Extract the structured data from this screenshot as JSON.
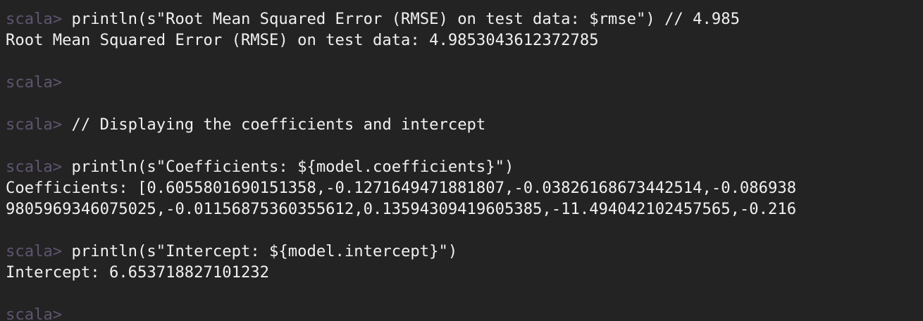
{
  "colors": {
    "background": "#232323",
    "text": "#f0f0f0",
    "prompt": "#5f5470"
  },
  "terminal": {
    "lines": [
      {
        "prompt": "scala> ",
        "text": "println(s\"Root Mean Squared Error (RMSE) on test data: $rmse\") // 4.985"
      },
      {
        "prompt": "",
        "text": "Root Mean Squared Error (RMSE) on test data: 4.9853043612372785"
      },
      {
        "prompt": "",
        "text": ""
      },
      {
        "prompt": "scala>",
        "text": ""
      },
      {
        "prompt": "",
        "text": ""
      },
      {
        "prompt": "scala> ",
        "text": "// Displaying the coefficients and intercept"
      },
      {
        "prompt": "",
        "text": ""
      },
      {
        "prompt": "scala> ",
        "text": "println(s\"Coefficients: ${model.coefficients}\")"
      },
      {
        "prompt": "",
        "text": "Coefficients: [0.6055801690151358,-0.1271649471881807,-0.03826168673442514,-0.086938"
      },
      {
        "prompt": "",
        "text": "9805969346075025,-0.01156875360355612,0.13594309419605385,-11.494042102457565,-0.216"
      },
      {
        "prompt": "",
        "text": ""
      },
      {
        "prompt": "scala> ",
        "text": "println(s\"Intercept: ${model.intercept}\")"
      },
      {
        "prompt": "",
        "text": "Intercept: 6.653718827101232"
      },
      {
        "prompt": "",
        "text": ""
      },
      {
        "prompt": "scala>",
        "text": ""
      }
    ]
  }
}
